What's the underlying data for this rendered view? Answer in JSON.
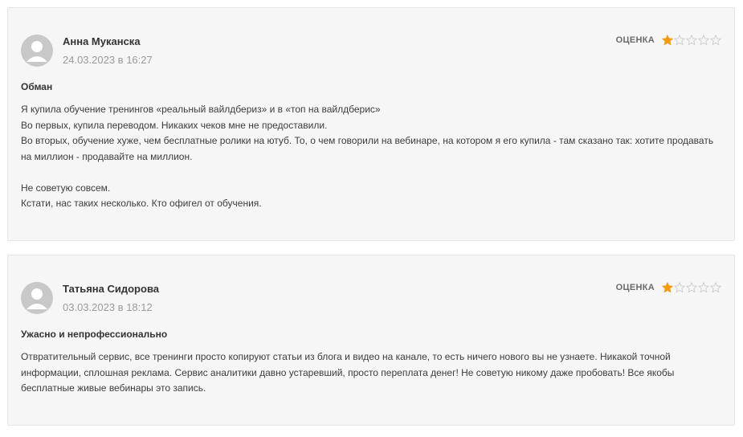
{
  "rating_label": "ОЦЕНКА",
  "colors": {
    "star_filled": "#f39c12",
    "star_empty": "#cfcfcf",
    "avatar_bg": "#c8c8c8",
    "card_bg": "#f6f6f6"
  },
  "reviews": [
    {
      "author": "Анна Муканска",
      "date": "24.03.2023 в 16:27",
      "rating": 1,
      "max_rating": 5,
      "title": "Обман",
      "lines": [
        "Я купила обучение тренингов «реальный вайлдбериз» и в «топ на вайлдберис»",
        "Во первых, купила переводом. Никаких чеков мне не предоставили.",
        "Во вторых, обучение хуже, чем бесплатные ролики на ютуб. То, о чем говорили на вебинаре, на котором я его купила - там сказано так: хотите продавать на миллион - продавайте на миллион.",
        "",
        "Не советую совсем.",
        "Кстати, нас таких несколько. Кто офигел от обучения."
      ]
    },
    {
      "author": "Татьяна Сидорова",
      "date": "03.03.2023 в 18:12",
      "rating": 1,
      "max_rating": 5,
      "title": "Ужасно и непрофессионально",
      "lines": [
        "Отвратительный сервис, все тренинги просто копируют статьи из блога и видео на канале, то есть ничего нового вы не узнаете. Никакой точной информации, сплошная реклама. Сервис аналитики давно устаревший, просто переплата денег! Не советую никому даже пробовать! Все якобы бесплатные живые вебинары это запись."
      ]
    }
  ]
}
